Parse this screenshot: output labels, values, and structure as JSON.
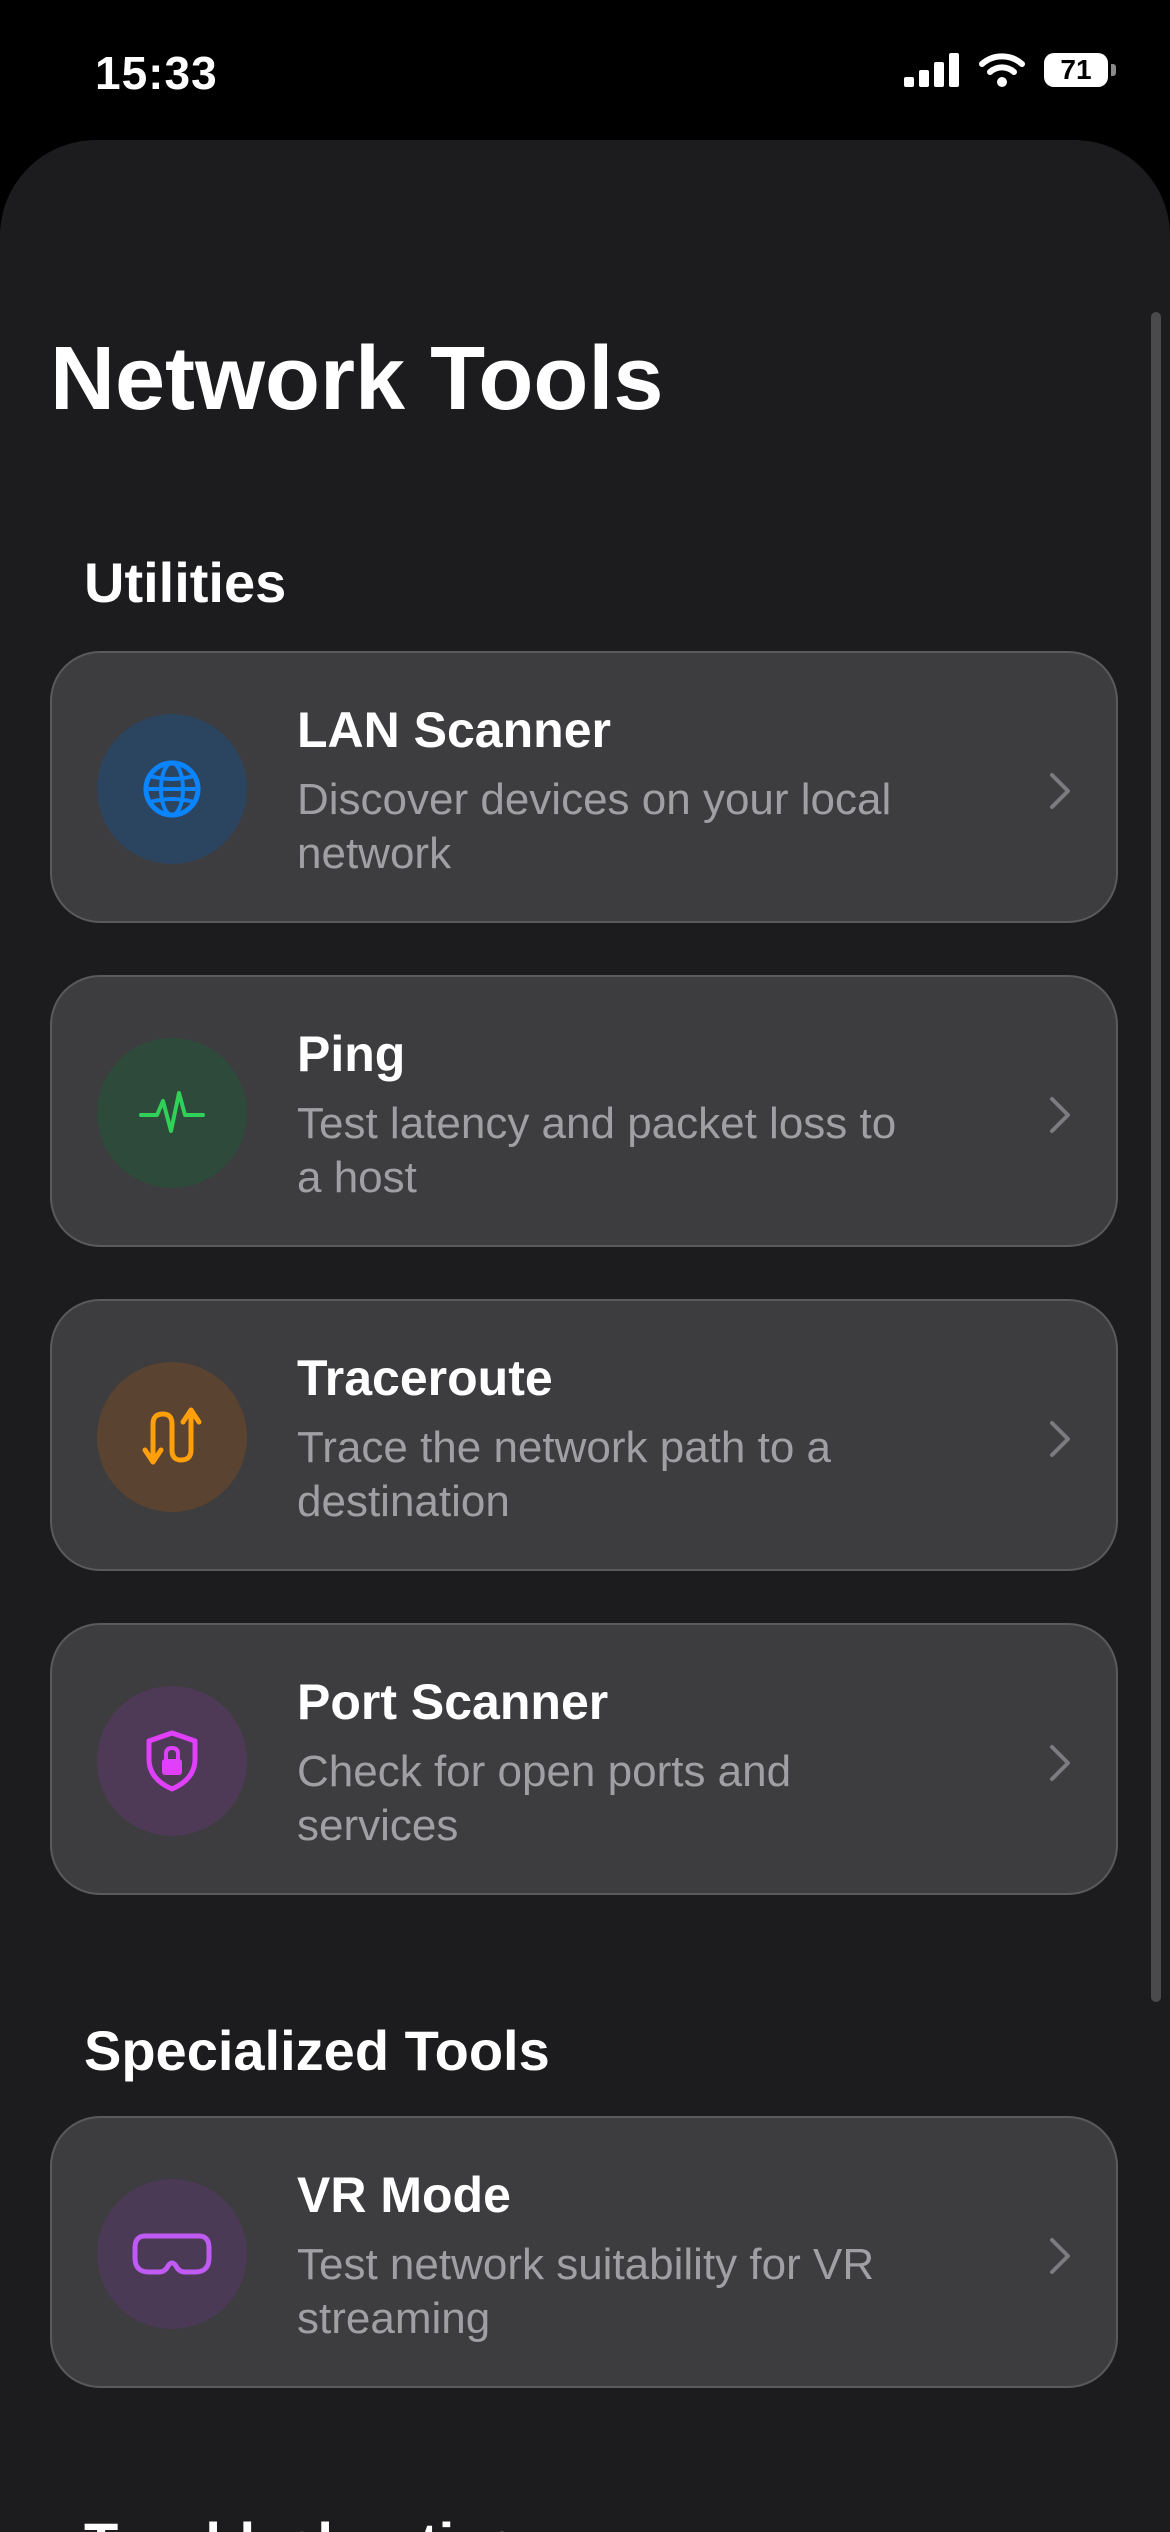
{
  "status_bar": {
    "time": "15:33",
    "battery": "71"
  },
  "page": {
    "title": "Network Tools"
  },
  "sections": [
    {
      "title": "Utilities",
      "items": [
        {
          "title": "LAN Scanner",
          "description": "Discover devices on your local network",
          "icon": "globe-icon",
          "accent": "#0a84ff"
        },
        {
          "title": "Ping",
          "description": "Test latency and packet loss to a host",
          "icon": "waveform-icon",
          "accent": "#30d158"
        },
        {
          "title": "Traceroute",
          "description": "Trace the network path to a destination",
          "icon": "route-arrows-icon",
          "accent": "#ff9f0a"
        },
        {
          "title": "Port Scanner",
          "description": "Check for open ports and services",
          "icon": "lock-shield-icon",
          "accent": "#bf5af2"
        }
      ]
    },
    {
      "title": "Specialized Tools",
      "items": [
        {
          "title": "VR Mode",
          "description": "Test network suitability for VR streaming",
          "icon": "vr-headset-icon",
          "accent": "#bf5af2"
        }
      ]
    }
  ],
  "next_section_partial_title": "Troubleshooting"
}
